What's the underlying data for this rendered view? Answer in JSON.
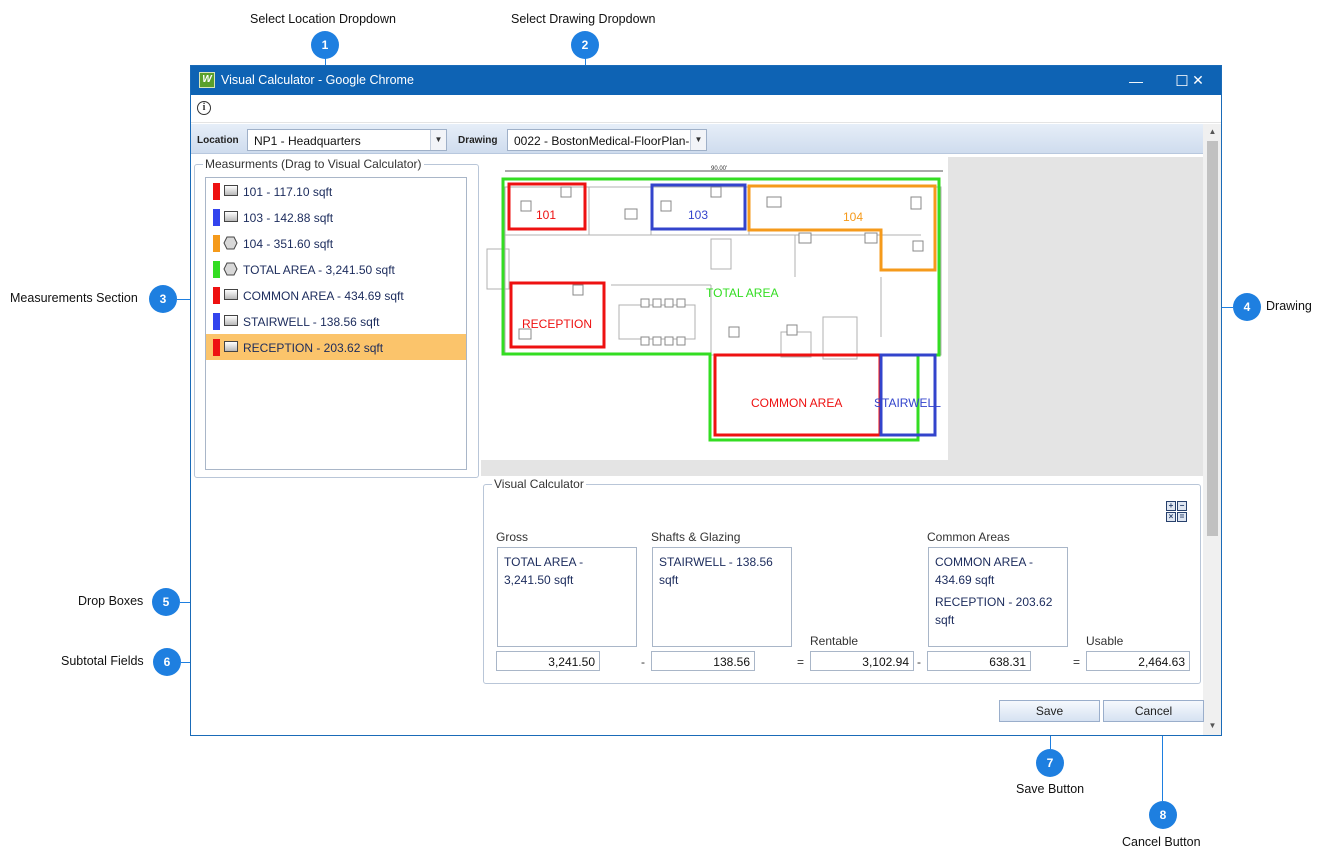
{
  "annotations": {
    "select_location": {
      "number": "1",
      "label": "Select Location Dropdown"
    },
    "select_drawing": {
      "number": "2",
      "label": "Select Drawing Dropdown"
    },
    "measurements_section": {
      "number": "3",
      "label": "Measurements Section"
    },
    "drawing": {
      "number": "4",
      "label": "Drawing"
    },
    "drop_boxes": {
      "number": "5",
      "label": "Drop Boxes"
    },
    "subtotal_fields": {
      "number": "6",
      "label": "Subtotal Fields"
    },
    "save_button": {
      "number": "7",
      "label": "Save Button"
    },
    "cancel_button": {
      "number": "8",
      "label": "Cancel Button"
    }
  },
  "window": {
    "title": "Visual Calculator - Google Chrome",
    "icon_letter": "W",
    "controls": {
      "minimize": "—",
      "maximize": "☐",
      "close": "✕"
    }
  },
  "info_icon": "i",
  "toolbar": {
    "location_label": "Location",
    "location_value": "NP1 - Headquarters",
    "drawing_label": "Drawing",
    "drawing_value": "0022 - BostonMedical-FloorPlan-",
    "arrow": "▼"
  },
  "measurements": {
    "title": "Measurments (Drag to Visual Calculator)",
    "items": [
      {
        "color": "#ee1111",
        "shape": "rect",
        "label": "101 - 117.10 sqft",
        "selected": false
      },
      {
        "color": "#3344ee",
        "shape": "rect",
        "label": "103 - 142.88 sqft",
        "selected": false
      },
      {
        "color": "#f59a1b",
        "shape": "hex",
        "label": "104 - 351.60 sqft",
        "selected": false
      },
      {
        "color": "#33dd22",
        "shape": "hex",
        "label": "TOTAL AREA - 3,241.50 sqft",
        "selected": false
      },
      {
        "color": "#ee1111",
        "shape": "rect",
        "label": "COMMON AREA - 434.69 sqft",
        "selected": false
      },
      {
        "color": "#3344ee",
        "shape": "rect",
        "label": "STAIRWELL - 138.56 sqft",
        "selected": false
      },
      {
        "color": "#ee1111",
        "shape": "rect",
        "label": "RECEPTION - 203.62 sqft",
        "selected": true
      }
    ]
  },
  "drawing": {
    "dimension": "90.00'",
    "rooms": {
      "r101": {
        "label": "101",
        "color": "#ee1111"
      },
      "r103": {
        "label": "103",
        "color": "#3344cc"
      },
      "r104": {
        "label": "104",
        "color": "#f59a1b"
      },
      "total": {
        "label": "TOTAL AREA",
        "color": "#33dd22"
      },
      "reception": {
        "label": "RECEPTION",
        "color": "#ee1111"
      },
      "common": {
        "label": "COMMON AREA",
        "color": "#ee1111"
      },
      "stairwell": {
        "label": "STAIRWELL",
        "color": "#3344cc"
      }
    }
  },
  "calculator": {
    "title": "Visual Calculator",
    "gross": {
      "label": "Gross",
      "items": [
        "TOTAL AREA - 3,241.50 sqft"
      ],
      "subtotal": "3,241.50"
    },
    "shafts": {
      "label": "Shafts & Glazing",
      "items": [
        "STAIRWELL - 138.56 sqft"
      ],
      "subtotal": "138.56"
    },
    "rentable": {
      "label": "Rentable",
      "value": "3,102.94"
    },
    "common": {
      "label": "Common Areas",
      "items": [
        "COMMON AREA - 434.69 sqft",
        "RECEPTION - 203.62 sqft"
      ],
      "subtotal": "638.31"
    },
    "usable": {
      "label": "Usable",
      "value": "2,464.63"
    },
    "operators": {
      "minus": "-",
      "equals": "="
    },
    "tools": [
      "+",
      "−",
      "×",
      "="
    ]
  },
  "buttons": {
    "save": "Save",
    "cancel": "Cancel"
  }
}
